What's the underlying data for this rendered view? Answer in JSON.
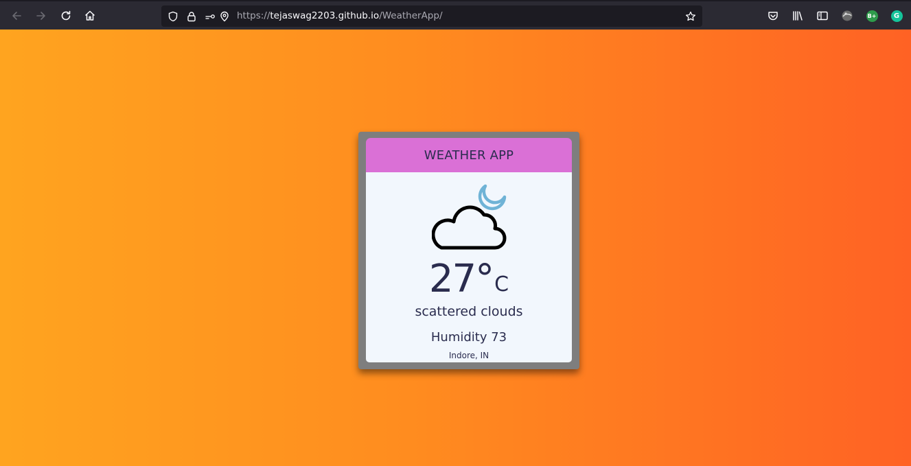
{
  "browser": {
    "url_scheme": "https://",
    "url_host": "tejaswag2203.github.io",
    "url_path": "/WeatherApp/",
    "extensions": [
      {
        "name": "bplus-extension",
        "label": "B+",
        "color": "#2e9b4b"
      },
      {
        "name": "grammarly-extension",
        "label": "G",
        "color": "#15c39a"
      }
    ]
  },
  "app": {
    "title": "WEATHER APP",
    "temperature": "27°",
    "unit": "C",
    "description": "scattered clouds",
    "humidity": "Humidity 73",
    "location": "Indore, IN",
    "icon": "cloud-moon-icon"
  },
  "colors": {
    "gradient_start": "#ffa41f",
    "gradient_end": "#ff6224",
    "header_bg": "#da70d6",
    "card_frame": "#7e7e7e",
    "card_body": "#f2f7fd",
    "text": "#2a2c4e",
    "moon": "#6fb3d6"
  }
}
